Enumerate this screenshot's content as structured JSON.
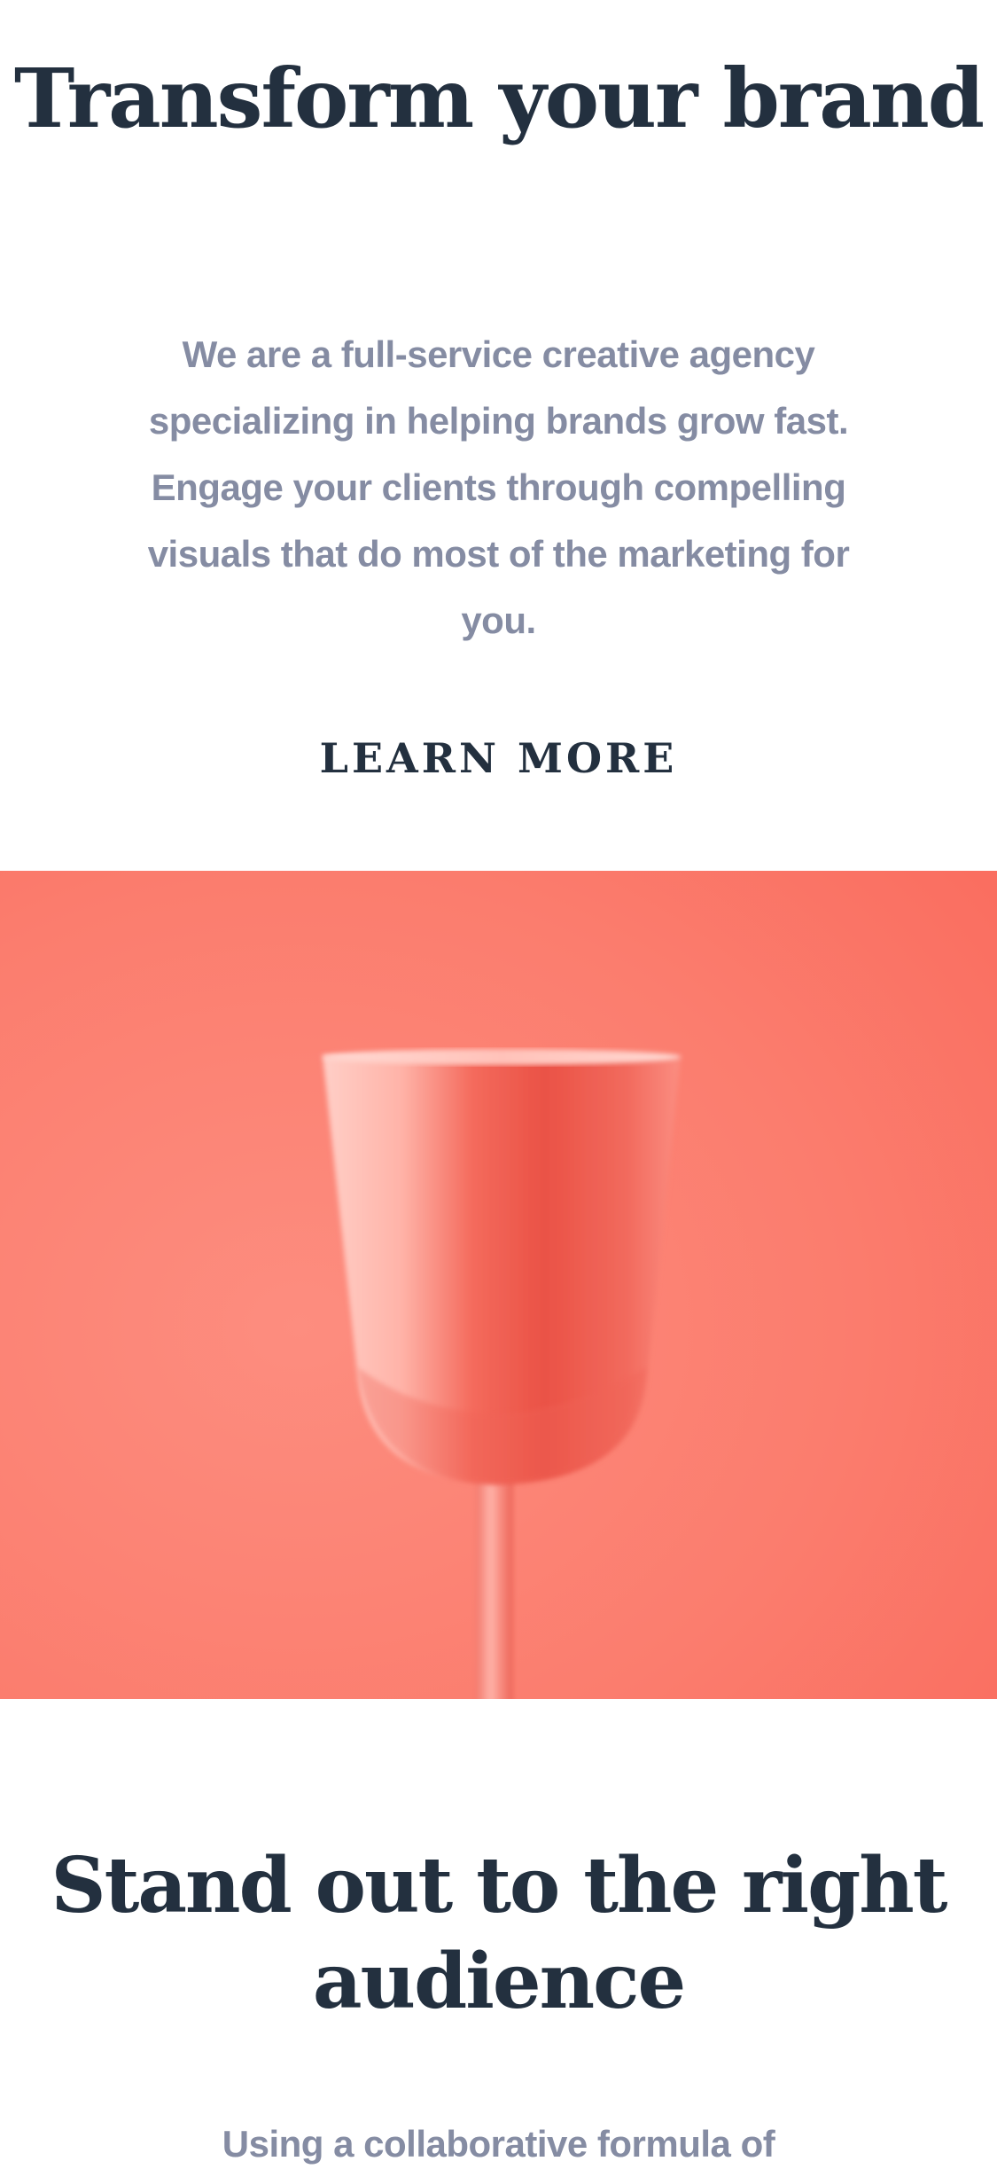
{
  "hero": {
    "title": "Transform your brand",
    "description": "We are a full-service creative agency specializing in helping brands grow fast. Engage your clients through compelling visuals that do most of the marketing for you.",
    "cta_label": "LEARN MORE"
  },
  "image": {
    "subject": "coral-glass-on-coral-background",
    "background_color": "#fa7b6c",
    "object_color": "#f26355"
  },
  "section_two": {
    "title": "Stand out to the right audience",
    "description_partial": "Using a collaborative formula of"
  },
  "colors": {
    "heading": "#23303f",
    "body_text": "#858ca3",
    "background": "#ffffff"
  }
}
